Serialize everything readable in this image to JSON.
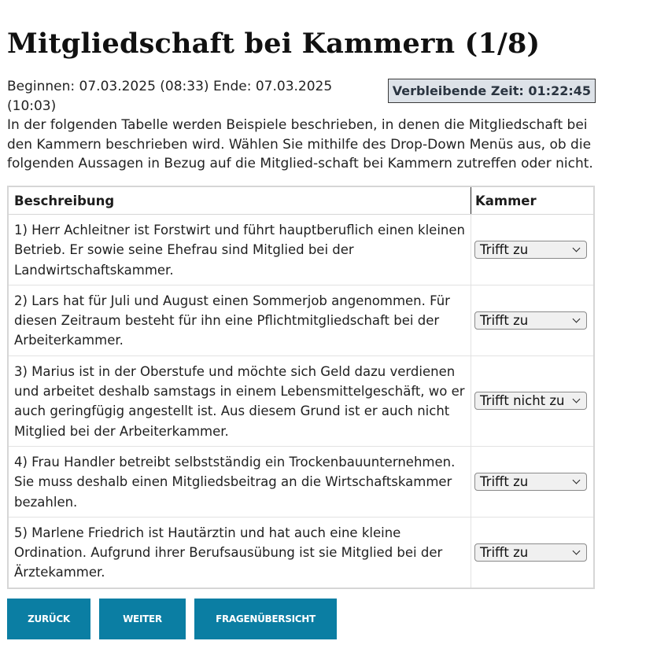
{
  "page": {
    "title": "Mitgliedschaft bei Kammern (1/8)"
  },
  "info": {
    "times": "Beginnen: 07.03.2025 (08:33) Ende: 07.03.2025 (10:03)",
    "instructions": "In der folgenden Tabelle werden Beispiele beschrieben, in denen die Mitgliedschaft bei den Kammern beschrieben wird. Wählen Sie mithilfe des Drop-Down Menüs aus, ob die folgenden Aussagen in Bezug auf die Mitglied-schaft bei Kammern zutreffen oder nicht."
  },
  "timer": {
    "label": "Verbleibende Zeit: 01:22:45"
  },
  "table": {
    "headers": {
      "description": "Beschreibung",
      "chamber": "Kammer"
    },
    "rows": [
      {
        "text": "1) Herr Achleitner ist Forstwirt und führt hauptberuflich einen kleinen Betrieb. Er sowie seine Ehefrau sind Mitglied bei der Landwirtschaftskammer.",
        "selected": "Trifft zu"
      },
      {
        "text": "2) Lars hat für Juli und August einen Sommerjob angenommen. Für diesen Zeitraum besteht für ihn eine Pflichtmitgliedschaft bei der Arbeiterkammer.",
        "selected": "Trifft zu"
      },
      {
        "text": "3) Marius ist in der Oberstufe und möchte sich Geld dazu verdienen und arbeitet deshalb samstags in einem Lebensmittelgeschäft, wo er auch geringfügig angestellt ist. Aus diesem Grund ist er auch nicht Mitglied bei der Arbeiterkammer.",
        "selected": "Trifft nicht zu"
      },
      {
        "text": "4) Frau Handler betreibt selbstständig ein Trockenbauunternehmen. Sie muss deshalb einen Mitgliedsbeitrag an die Wirtschaftskammer bezahlen.",
        "selected": "Trifft zu"
      },
      {
        "text": "5) Marlene Friedrich ist Hautärztin und hat auch eine kleine Ordination. Aufgrund ihrer Berufsausübung ist sie Mitglied bei der Ärztekammer.",
        "selected": "Trifft zu"
      }
    ]
  },
  "buttons": {
    "back": "Zurück",
    "next": "Weiter",
    "overview": "Fragenübersicht"
  },
  "colors": {
    "button_bg": "#0b7ea3",
    "timer_bg": "#dde2e8"
  }
}
